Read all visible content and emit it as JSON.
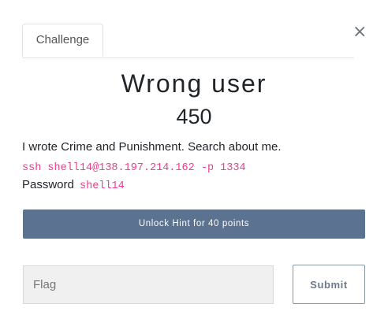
{
  "modal": {
    "close_label": "×",
    "tabs": [
      {
        "label": "Challenge",
        "active": true
      }
    ]
  },
  "challenge": {
    "name": "Wrong user",
    "points": "450",
    "description": "I wrote Crime and Punishment. Search about me.",
    "command": "ssh shell14@138.197.214.162 -p 1334",
    "password_label": "Password",
    "password_value": "shell14"
  },
  "hint": {
    "button_label": "Unlock Hint for 40 points"
  },
  "form": {
    "flag_placeholder": "Flag",
    "flag_value": "",
    "submit_label": "Submit"
  },
  "colors": {
    "hint_button_bg": "#5b7290",
    "code_color": "#e83e8c",
    "submit_border": "#8a95a3"
  }
}
